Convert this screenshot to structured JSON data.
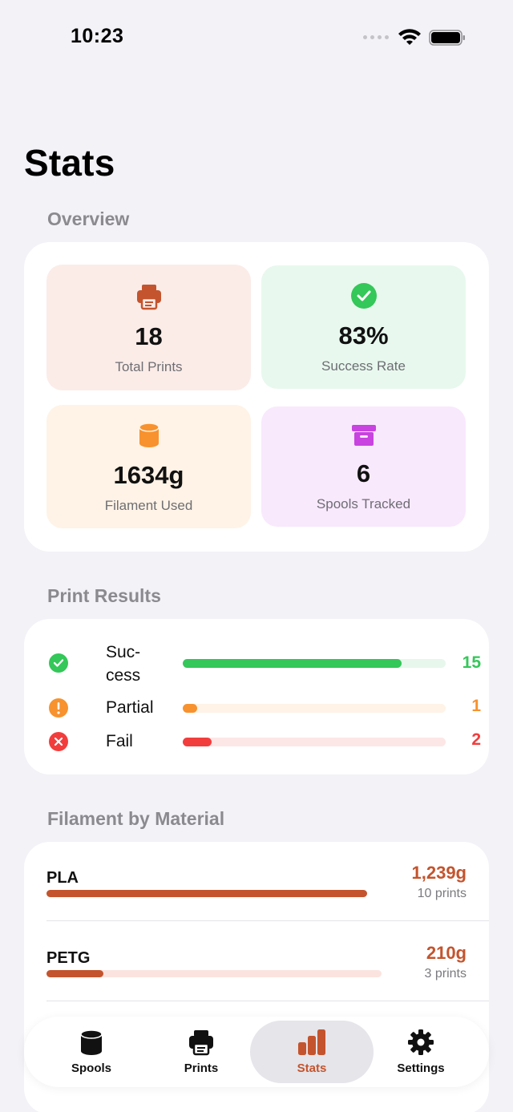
{
  "status_bar": {
    "time": "10:23"
  },
  "page_title": "Stats",
  "colors": {
    "accent": "#c4542d",
    "success": "#34c759",
    "partial": "#f7922e",
    "fail": "#f23d3d",
    "purple": "#c843e0"
  },
  "overview": {
    "label": "Overview",
    "tiles": [
      {
        "icon": "printer-icon",
        "value": "18",
        "label": "Total Prints"
      },
      {
        "icon": "checkmark-circle-icon",
        "value": "83%",
        "label": "Success Rate"
      },
      {
        "icon": "spool-cylinder-icon",
        "value": "1634g",
        "label": "Filament Used"
      },
      {
        "icon": "archive-box-icon",
        "value": "6",
        "label": "Spools Tracked"
      }
    ]
  },
  "print_results": {
    "label": "Print Results",
    "rows": [
      {
        "icon": "checkmark-circle-icon",
        "label": "Suc-\ncess",
        "count": "15",
        "fraction": 0.833
      },
      {
        "icon": "exclamation-circle-icon",
        "label": "Partial",
        "count": "1",
        "fraction": 0.056
      },
      {
        "icon": "x-circle-icon",
        "label": "Fail",
        "count": "2",
        "fraction": 0.111
      }
    ]
  },
  "filament_by_material": {
    "label": "Filament by Material",
    "rows": [
      {
        "name": "PLA",
        "weight": "1,239g",
        "prints": "10 prints",
        "fraction": 1.0
      },
      {
        "name": "PETG",
        "weight": "210g",
        "prints": "3 prints",
        "fraction": 0.17
      }
    ]
  },
  "tab_bar": {
    "tabs": [
      {
        "icon": "spool-icon",
        "label": "Spools",
        "active": false
      },
      {
        "icon": "printer-icon",
        "label": "Prints",
        "active": false
      },
      {
        "icon": "bar-chart-icon",
        "label": "Stats",
        "active": true
      },
      {
        "icon": "gear-icon",
        "label": "Settings",
        "active": false
      }
    ]
  }
}
